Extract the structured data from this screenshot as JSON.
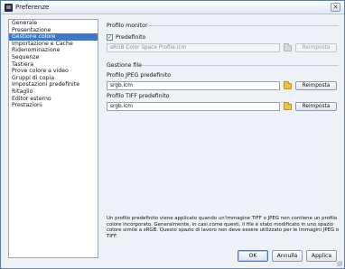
{
  "window": {
    "title": "Preferenze",
    "icon": "app-icon",
    "close_glyph": "✕"
  },
  "sidebar": {
    "items": [
      {
        "label": "Generale",
        "selected": false
      },
      {
        "label": "Presentazione",
        "selected": false
      },
      {
        "label": "Gestione colore",
        "selected": true
      },
      {
        "label": "Importazione e Cache",
        "selected": false
      },
      {
        "label": "Ridenominazione",
        "selected": false
      },
      {
        "label": "Sequenze",
        "selected": false
      },
      {
        "label": "Tastiera",
        "selected": false
      },
      {
        "label": "Prove colore a video",
        "selected": false
      },
      {
        "label": "Gruppi di copia",
        "selected": false
      },
      {
        "label": "Impostazioni predefinite",
        "selected": false
      },
      {
        "label": "Ritaglio",
        "selected": false
      },
      {
        "label": "Editor esterno",
        "selected": false
      },
      {
        "label": "Prestazioni",
        "selected": false
      }
    ]
  },
  "monitor": {
    "section_title": "Profilo monitor",
    "default_checkbox_label": "Predefinito",
    "default_checked": true,
    "check_glyph": "✓",
    "profile_value": "sRGB Color Space Profile.icm",
    "reset_label": "Reimposta"
  },
  "files": {
    "section_title": "Gestione file",
    "jpeg_label": "Profilo JPEG predefinito",
    "jpeg_value": "srgb.icm",
    "tiff_label": "Profilo TIFF predefinito",
    "tiff_value": "srgb.icm",
    "reset_label": "Reimposta"
  },
  "note": "Un profilo predefinito viene applicato quando un'immagine TIFF o JPEG non contiene un profilo colore incorporato. Generalmente, in casi come questi, il file è stato modificato in uno spazio colore simile a sRGB. Questo spazio di lavoro non deve essere utilizzato per le immagini JPEG o TIFF.",
  "footer": {
    "ok": "OK",
    "cancel": "Annulla",
    "apply": "Applica"
  }
}
